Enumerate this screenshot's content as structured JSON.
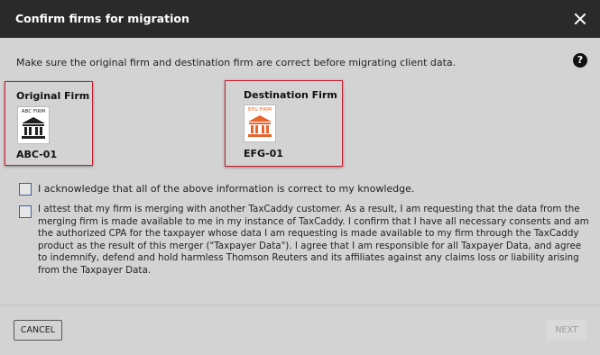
{
  "dialog": {
    "title": "Confirm firms for migration",
    "intro": "Make sure the original firm and destination firm are correct before migrating client data.",
    "help_icon": "?"
  },
  "original_firm": {
    "label": "Original Firm",
    "logo_text": "ABC FIRM",
    "logo_color": "#222222",
    "code": "ABC-01",
    "icon": "bank-icon"
  },
  "destination_firm": {
    "label": "Destination Firm",
    "logo_text": "EFG FIRM",
    "logo_color": "#e8642c",
    "code": "EFG-01",
    "icon": "bank-icon"
  },
  "acknowledgements": {
    "ack": "I acknowledge that all of the above information is correct to my knowledge.",
    "attest": "I attest that my firm is merging with another TaxCaddy customer.  As a result, I am requesting that the data from the merging firm is made available to me in my instance of TaxCaddy.  I confirm that I have all necessary consents and am the authorized CPA for the taxpayer whose data I am requesting is made available to my firm through the TaxCaddy product as the result of this merger (\"Taxpayer Data\").  I agree that I am responsible for all Taxpayer Data, and agree to indemnify, defend and hold harmless Thomson Reuters and its affiliates against any claims loss or liability arising from the Taxpayer Data."
  },
  "footer": {
    "cancel": "CANCEL",
    "next": "NEXT"
  },
  "colors": {
    "highlight_border": "#d0182b",
    "checkbox_border": "#3a5fa0"
  }
}
